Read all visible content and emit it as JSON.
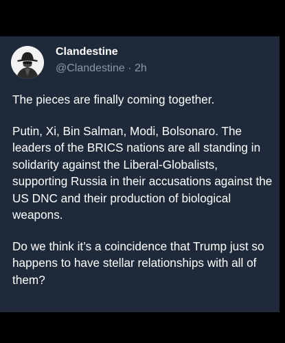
{
  "post": {
    "author": {
      "display_name": "Clandestine",
      "handle": "@Clandestine",
      "separator": "·",
      "timestamp": "2h",
      "avatar_icon": "spy-figure-icon"
    },
    "paragraphs": [
      "The pieces are finally coming together.",
      "Putin, Xi, Bin Salman, Modi, Bolsonaro. The leaders of the BRICS nations are all standing in solidarity against the Liberal-Globalists, supporting Russia in their accusations against the US DNC and their production of biological weapons.",
      "Do we think it’s a coincidence that Trump just so happens to have stellar relationships with all of them?"
    ]
  },
  "colors": {
    "background": "#000000",
    "card": "#1e2a3a",
    "text": "#ffffff",
    "muted": "#8899a6"
  }
}
